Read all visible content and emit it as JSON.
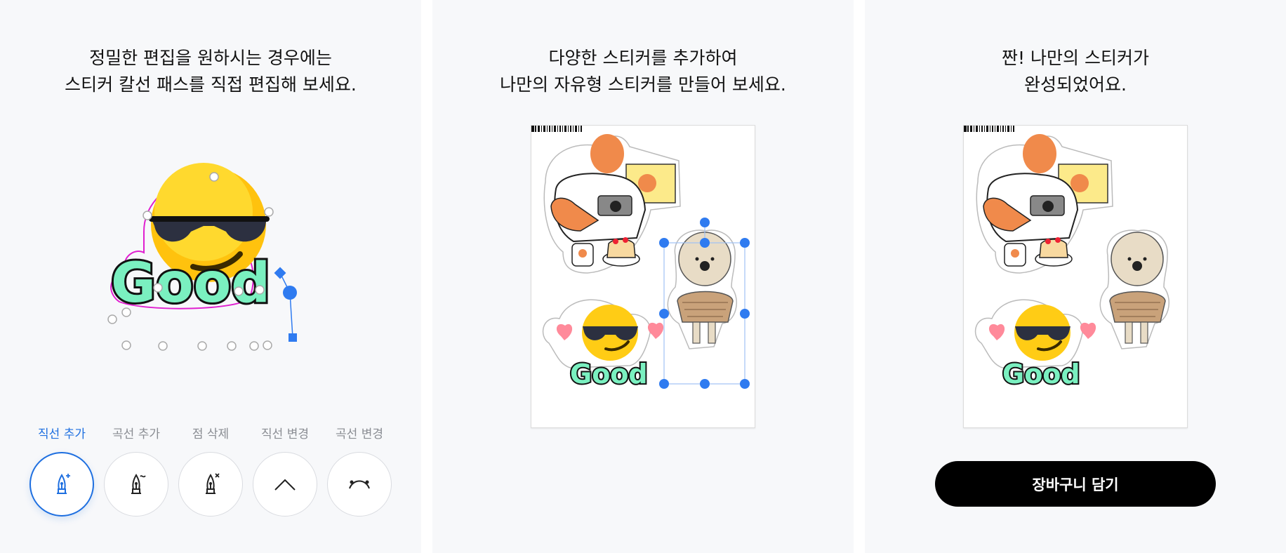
{
  "panels": [
    {
      "heading": [
        "정밀한 편집을 원하시는 경우에는",
        "스티커 칼선 패스를 직접 편집해 보세요."
      ]
    },
    {
      "heading": [
        "다양한 스티커를 추가하여",
        "나만의 자유형 스티커를 만들어 보세요."
      ]
    },
    {
      "heading": [
        "짠! 나만의 스티커가",
        "완성되었어요."
      ]
    }
  ],
  "sticker_text": "Good",
  "tools": [
    {
      "label": "직선 추가",
      "icon": "pen-plus-icon",
      "active": true
    },
    {
      "label": "곡선 추가",
      "icon": "pen-curve-icon",
      "active": false
    },
    {
      "label": "점 삭제",
      "icon": "pen-delete-icon",
      "active": false
    },
    {
      "label": "직선 변경",
      "icon": "angle-line-icon",
      "active": false
    },
    {
      "label": "곡선 변경",
      "icon": "curve-line-icon",
      "active": false
    }
  ],
  "cart_button_label": "장바구니 담기",
  "colors": {
    "accent": "#1e6fe0",
    "cut_path": "#e020d0",
    "handle": "#2f7bf0",
    "button_bg": "#000000"
  }
}
